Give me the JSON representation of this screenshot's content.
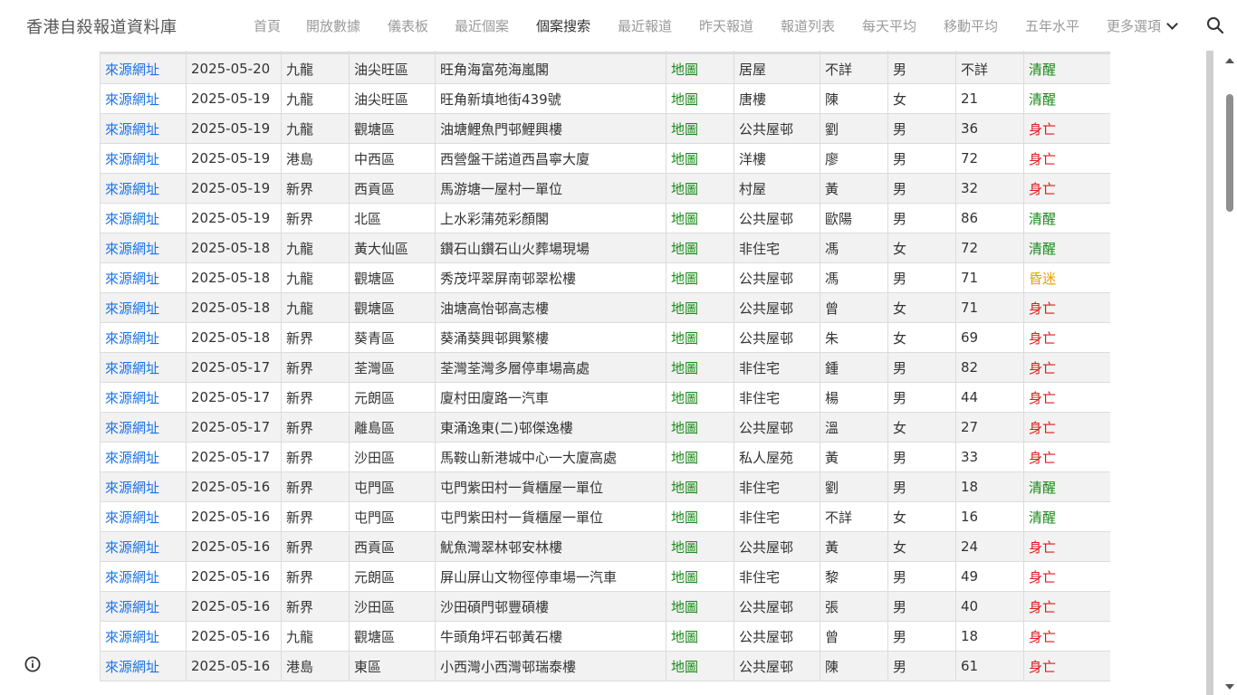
{
  "header": {
    "site_title": "香港自殺報道資料庫",
    "nav": [
      "首頁",
      "開放數據",
      "儀表板",
      "最近個案",
      "個案搜索",
      "最近報道",
      "昨天報道",
      "報道列表",
      "每天平均",
      "移動平均",
      "五年水平",
      "更多選項"
    ],
    "active_nav": "個案搜索",
    "search_icon": "search-icon"
  },
  "table": {
    "link_label": "來源網址",
    "map_label": "地圖",
    "status_colors": {
      "清醒": "#1a8a1a",
      "身亡": "#e01b1b",
      "昏迷": "#e6a100"
    },
    "rows": [
      [
        "2025-05-20",
        "九龍",
        "油尖旺區",
        "旺角海富苑海嵐閣",
        "居屋",
        "不詳",
        "男",
        "不詳",
        "清醒"
      ],
      [
        "2025-05-19",
        "九龍",
        "油尖旺區",
        "旺角新填地街439號",
        "唐樓",
        "陳",
        "女",
        "21",
        "清醒"
      ],
      [
        "2025-05-19",
        "九龍",
        "觀塘區",
        "油塘鯉魚門邨鯉興樓",
        "公共屋邨",
        "劉",
        "男",
        "36",
        "身亡"
      ],
      [
        "2025-05-19",
        "港島",
        "中西區",
        "西營盤干諾道西昌寧大廈",
        "洋樓",
        "廖",
        "男",
        "72",
        "身亡"
      ],
      [
        "2025-05-19",
        "新界",
        "西貢區",
        "馬游塘一屋村一單位",
        "村屋",
        "黃",
        "男",
        "32",
        "身亡"
      ],
      [
        "2025-05-19",
        "新界",
        "北區",
        "上水彩蒲苑彩顏閣",
        "公共屋邨",
        "歐陽",
        "男",
        "86",
        "清醒"
      ],
      [
        "2025-05-18",
        "九龍",
        "黃大仙區",
        "鑽石山鑽石山火葬場現場",
        "非住宅",
        "馮",
        "女",
        "72",
        "清醒"
      ],
      [
        "2025-05-18",
        "九龍",
        "觀塘區",
        "秀茂坪翠屏南邨翠松樓",
        "公共屋邨",
        "馮",
        "男",
        "71",
        "昏迷"
      ],
      [
        "2025-05-18",
        "九龍",
        "觀塘區",
        "油塘高怡邨高志樓",
        "公共屋邨",
        "曾",
        "女",
        "71",
        "身亡"
      ],
      [
        "2025-05-18",
        "新界",
        "葵青區",
        "葵涌葵興邨興繁樓",
        "公共屋邨",
        "朱",
        "女",
        "69",
        "身亡"
      ],
      [
        "2025-05-17",
        "新界",
        "荃灣區",
        "荃灣荃灣多層停車場高處",
        "非住宅",
        "鍾",
        "男",
        "82",
        "身亡"
      ],
      [
        "2025-05-17",
        "新界",
        "元朗區",
        "廈村田廈路一汽車",
        "非住宅",
        "楊",
        "男",
        "44",
        "身亡"
      ],
      [
        "2025-05-17",
        "新界",
        "離島區",
        "東涌逸東(二)邨傑逸樓",
        "公共屋邨",
        "溫",
        "女",
        "27",
        "身亡"
      ],
      [
        "2025-05-17",
        "新界",
        "沙田區",
        "馬鞍山新港城中心一大廈高處",
        "私人屋苑",
        "黃",
        "男",
        "33",
        "身亡"
      ],
      [
        "2025-05-16",
        "新界",
        "屯門區",
        "屯門紫田村一貨櫃屋一單位",
        "非住宅",
        "劉",
        "男",
        "18",
        "清醒"
      ],
      [
        "2025-05-16",
        "新界",
        "屯門區",
        "屯門紫田村一貨櫃屋一單位",
        "非住宅",
        "不詳",
        "女",
        "16",
        "清醒"
      ],
      [
        "2025-05-16",
        "新界",
        "西貢區",
        "魷魚灣翠林邨安林樓",
        "公共屋邨",
        "黃",
        "女",
        "24",
        "身亡"
      ],
      [
        "2025-05-16",
        "新界",
        "元朗區",
        "屏山屏山文物徑停車場一汽車",
        "非住宅",
        "黎",
        "男",
        "49",
        "身亡"
      ],
      [
        "2025-05-16",
        "新界",
        "沙田區",
        "沙田碩門邨豐碩樓",
        "公共屋邨",
        "張",
        "男",
        "40",
        "身亡"
      ],
      [
        "2025-05-16",
        "九龍",
        "觀塘區",
        "牛頭角坪石邨黃石樓",
        "公共屋邨",
        "曾",
        "男",
        "18",
        "身亡"
      ],
      [
        "2025-05-16",
        "港島",
        "東區",
        "小西灣小西灣邨瑞泰樓",
        "公共屋邨",
        "陳",
        "男",
        "61",
        "身亡"
      ]
    ]
  },
  "footer": {
    "info_icon": "info-icon"
  }
}
